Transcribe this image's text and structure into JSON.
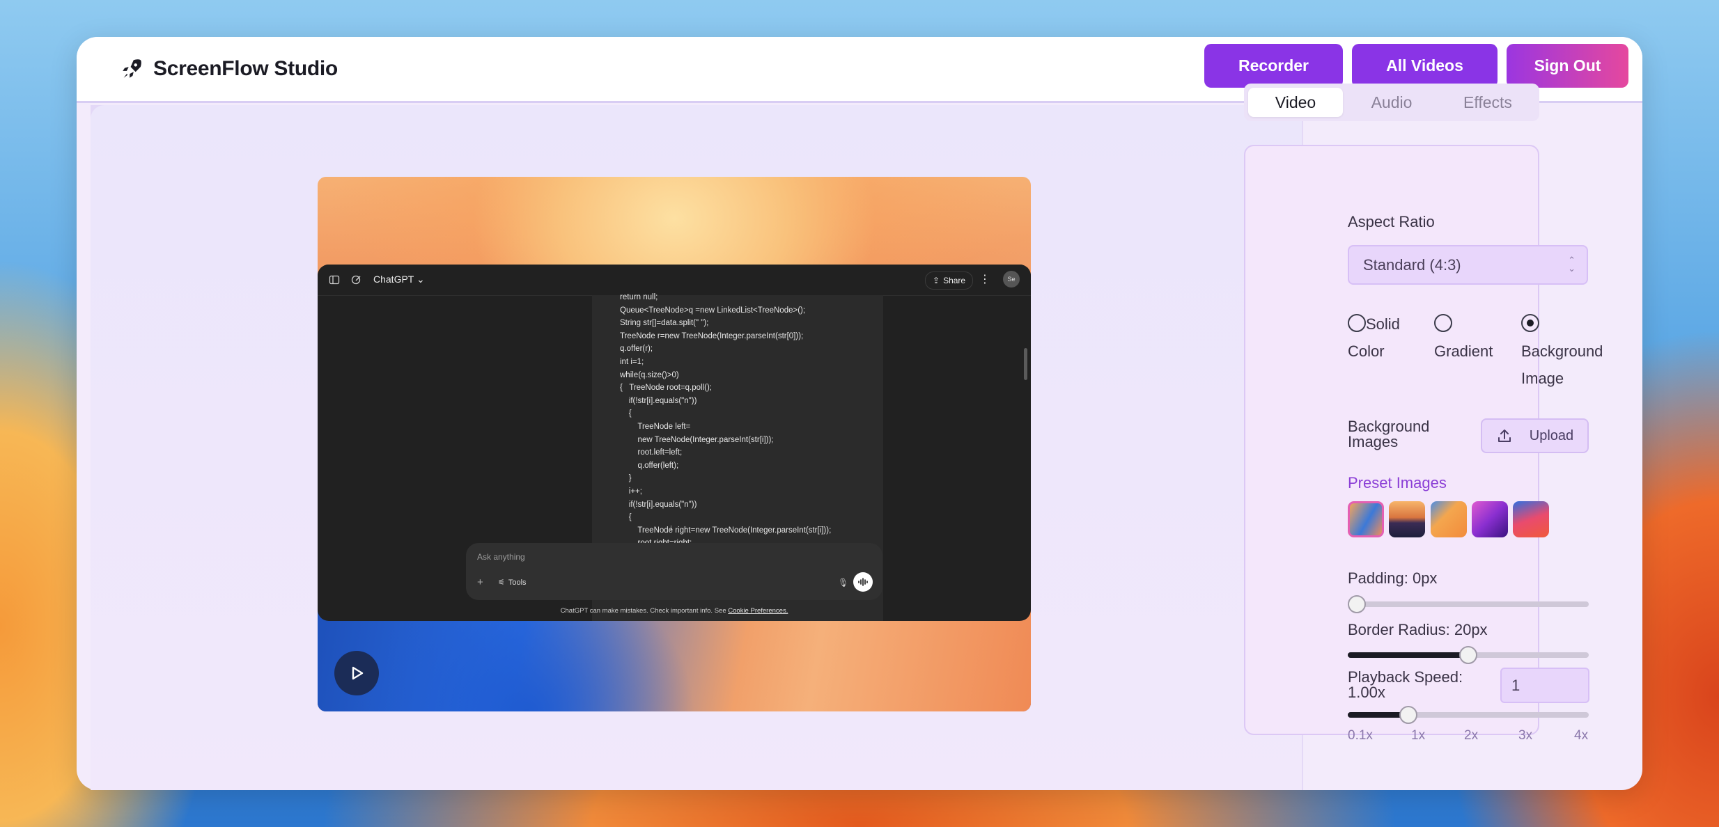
{
  "brand": {
    "name": "ScreenFlow Studio",
    "icon": "rocket-icon"
  },
  "nav": {
    "recorder": "Recorder",
    "all_videos": "All Videos",
    "sign_out": "Sign Out"
  },
  "preview": {
    "app_title": "ChatGPT",
    "share": "Share",
    "avatar": "Se",
    "code_lines": [
      "return null;",
      "Queue<TreeNode>q =new LinkedList<TreeNode>();",
      "String str[]=data.split(\" \");",
      "TreeNode r=new TreeNode(Integer.parseInt(str[0]));",
      "q.offer(r);",
      "int i=1;",
      "while(q.size()>0)",
      "{   TreeNode root=q.poll();",
      "    if(!str[i].equals(\"n\"))",
      "    {",
      "        TreeNode left=",
      "        new TreeNode(Integer.parseInt(str[i]));",
      "        root.left=left;",
      "        q.offer(left);",
      "    }",
      "    i++;",
      "    if(!str[i].equals(\"n\"))",
      "    {",
      "        TreeNode right=new TreeNode(Integer.parseInt(str[i]));",
      "        root.right=right;"
    ],
    "composer_placeholder": "Ask anything",
    "tools": "Tools",
    "disclaimer": "ChatGPT can make mistakes. Check important info. See",
    "disclaimer_link": "Cookie Preferences."
  },
  "tabs": {
    "video": "Video",
    "audio": "Audio",
    "effects": "Effects",
    "active": "Video"
  },
  "settings": {
    "aspect_ratio_label": "Aspect Ratio",
    "aspect_ratio_value": "Standard (4:3)",
    "background_types": [
      {
        "line1": "Solid",
        "line2": "Color",
        "selected": false
      },
      {
        "line1": "",
        "line2": "Gradient",
        "selected": false
      },
      {
        "line1": "",
        "line2": "Background",
        "line3": "Image",
        "selected": true
      }
    ],
    "background_images_label_1": "Background",
    "background_images_label_2": "Images",
    "upload": "Upload",
    "preset_images_label": "Preset Images",
    "padding_label": "Padding: 0px",
    "padding_value": 0,
    "border_radius_label": "Border Radius: 20px",
    "border_radius_fraction": 0.5,
    "playback_label_1": "Playback Speed:",
    "playback_label_2": "1.00x",
    "playback_input": "1",
    "playback_fraction": 0.25,
    "speed_ticks": [
      "0.1x",
      "1x",
      "2x",
      "3x",
      "4x"
    ]
  },
  "colors": {
    "accent": "#8a34e6",
    "signout_gradient_end": "#e5489e",
    "panel_bg": "#f4e7fb"
  }
}
